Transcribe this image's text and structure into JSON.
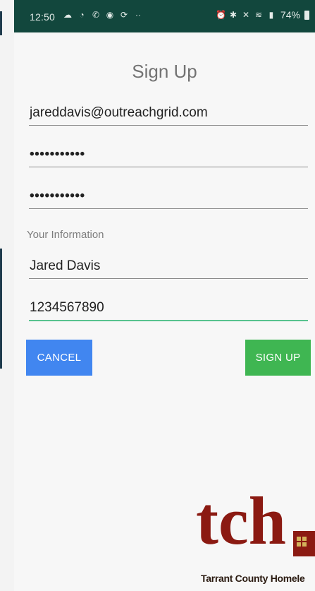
{
  "status_bar": {
    "time": "12:50",
    "notification_icons": [
      "cloud-icon",
      "chat-icon",
      "phone-icon",
      "message-icon",
      "sync-icon"
    ],
    "more": "··",
    "battery": "74%"
  },
  "form": {
    "title": "Sign Up",
    "email_value": "jareddavis@outreachgrid.com",
    "password_mask": "•••••••••••",
    "confirm_password_mask": "•••••••••••",
    "section_label": "Your Information",
    "name_value": "Jared Davis",
    "phone_value": "1234567890"
  },
  "buttons": {
    "cancel_label": "CANCEL",
    "signup_label": "SIGN UP"
  },
  "logo": {
    "letters": "tch",
    "caption": "Tarrant County Homele"
  },
  "colors": {
    "status_bar": "#12473d",
    "cancel_button": "#4186f0",
    "signup_button": "#3fb652",
    "focus_underline": "#57c28f",
    "logo_red": "#8b1a12"
  }
}
